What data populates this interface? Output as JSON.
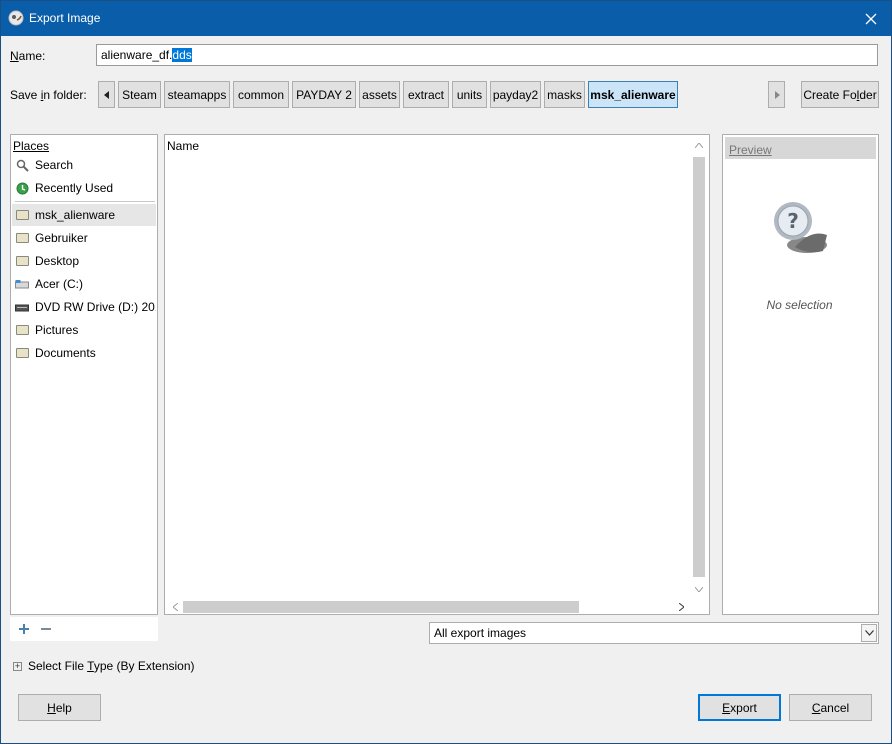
{
  "window": {
    "title": "Export Image",
    "app_icon": "gimp-icon",
    "close_icon": "close-icon"
  },
  "name_field": {
    "label_prefix": "N",
    "label_rest": "ame:",
    "value_base": "alienware_df.",
    "value_selected": "dds"
  },
  "save_in": {
    "label_pre": "Save ",
    "label_ul": "i",
    "label_post": "n folder:",
    "crumbs": [
      "Steam",
      "steamapps",
      "common",
      "PAYDAY 2",
      "assets",
      "extract",
      "units",
      "payday2",
      "masks",
      "msk_alienware"
    ],
    "active_crumb": "msk_alienware"
  },
  "create_folder": {
    "pre": "Create Fo",
    "ul": "l",
    "post": "der"
  },
  "places": {
    "header": "Places",
    "items": [
      {
        "label": "Search",
        "icon": "search-icon"
      },
      {
        "label": "Recently Used",
        "icon": "recent-icon"
      },
      {
        "label": "msk_alienware",
        "icon": "folder-icon"
      },
      {
        "label": "Gebruiker",
        "icon": "folder-icon"
      },
      {
        "label": "Desktop",
        "icon": "folder-icon"
      },
      {
        "label": "Acer (C:)",
        "icon": "drive-icon"
      },
      {
        "label": "DVD RW Drive (D:) 20...",
        "icon": "dvd-drive-icon"
      },
      {
        "label": "Pictures",
        "icon": "folder-icon"
      },
      {
        "label": "Documents",
        "icon": "folder-icon"
      }
    ]
  },
  "file_list": {
    "column_name": "Name"
  },
  "preview": {
    "header": "Preview",
    "no_selection": "No selection"
  },
  "filter": {
    "selected": "All export images"
  },
  "file_type": {
    "pre": "Select File ",
    "ul": "T",
    "post": "ype (By Extension)"
  },
  "buttons": {
    "help": {
      "ul": "H",
      "rest": "elp"
    },
    "export": {
      "ul": "E",
      "rest": "xport"
    },
    "cancel": {
      "ul": "C",
      "rest": "ancel"
    }
  },
  "colors": {
    "titlebar": "#0a5ea9",
    "accent": "#0078d7",
    "dialog_bg": "#f0f0f0"
  }
}
